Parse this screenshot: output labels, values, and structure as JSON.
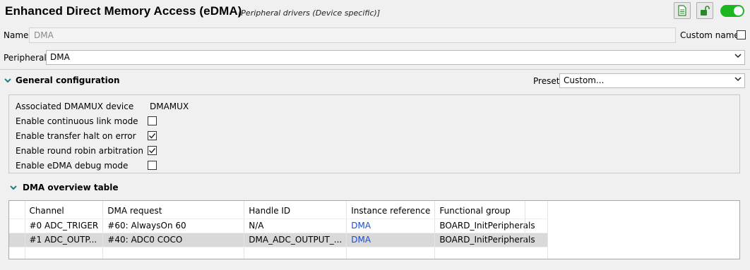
{
  "header": {
    "title": "Enhanced Direct Memory Access (eDMA)",
    "subtitle": "[Peripheral drivers (Device specific)]"
  },
  "toolbar": {
    "icons": [
      "document-icon",
      "unlock-icon",
      "toggle-switch"
    ],
    "enabled": true,
    "accent_color": "#1fb51f"
  },
  "name_row": {
    "label": "Name",
    "value": "DMA",
    "custom_name_label": "Custom name",
    "custom_name_checked": false
  },
  "peripheral_row": {
    "label": "Peripheral",
    "value": "DMA"
  },
  "general": {
    "heading": "General configuration",
    "preset_label": "Preset",
    "preset_value": "Custom...",
    "rows": [
      {
        "label": "Associated DMAMUX device",
        "value": "DMAMUX"
      },
      {
        "label": "Enable continuous link mode",
        "checked": false
      },
      {
        "label": "Enable transfer halt on error",
        "checked": true
      },
      {
        "label": "Enable round robin arbitration",
        "checked": true
      },
      {
        "label": "Enable eDMA debug mode",
        "checked": false
      }
    ]
  },
  "overview": {
    "heading": "DMA overview table",
    "columns": [
      "Channel",
      "DMA request",
      "Handle ID",
      "Instance reference",
      "Functional group"
    ],
    "rows": [
      {
        "channel": "#0 ADC_TRIGER",
        "request": "#60: AlwaysOn 60",
        "handle": "N/A",
        "instance": "DMA",
        "group": "BOARD_InitPeripherals"
      },
      {
        "channel": "#1 ADC_OUTP...",
        "request": "#40: ADC0 COCO",
        "handle": "DMA_ADC_OUTPUT_...",
        "instance": "DMA",
        "group": "BOARD_InitPeripherals"
      }
    ],
    "link_color": "#1a4bd6"
  }
}
